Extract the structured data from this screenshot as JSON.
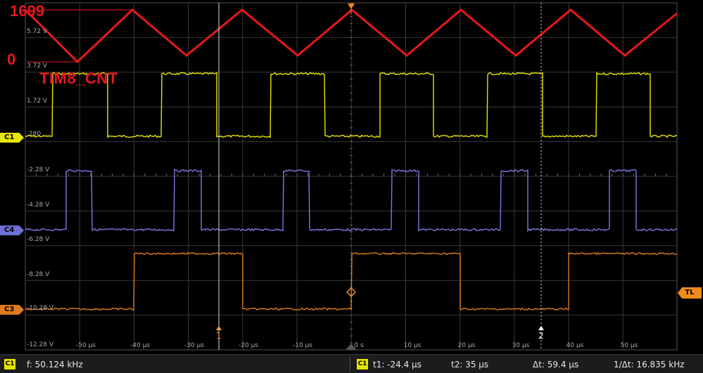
{
  "overlay": {
    "counter_max": "1699",
    "counter_min": "0",
    "signal_name": "TIM8_CNT"
  },
  "voltage_labels": [
    "5.72 V",
    "3.72 V",
    "1.72 V",
    ".280",
    "-2.28 V",
    "-4.28 V",
    "-6.28 V",
    "-8.28 V",
    "-10.28 V",
    "-12.28 V"
  ],
  "time_labels": [
    "-50 µs",
    "-40 µs",
    "-30 µs",
    "-20 µs",
    "-10 µs",
    "0 s",
    "10 µs",
    "20 µs",
    "30 µs",
    "40 µs",
    "50 µs"
  ],
  "channels": {
    "c1": {
      "label": "C1",
      "color": "#e6e600"
    },
    "c4": {
      "label": "C4",
      "color": "#7b78e0"
    },
    "c3": {
      "label": "C3",
      "color": "#e07b1b"
    }
  },
  "trigger_level_label": "TL",
  "cursors": {
    "cursor1_label": "1",
    "cursor2_label": "2"
  },
  "status": {
    "channel": "C1",
    "frequency": "f: 50.124 kHz",
    "cursor_channel": "C1",
    "t1": "t1: -24.4 µs",
    "t2": "t2: 35 µs",
    "dt": "Δt: 59.4 µs",
    "inv_dt": "1/Δt: 16.835 kHz"
  },
  "colors": {
    "counter": "#e8171b",
    "grid": "#3a3a3a",
    "background": "#000000"
  }
}
